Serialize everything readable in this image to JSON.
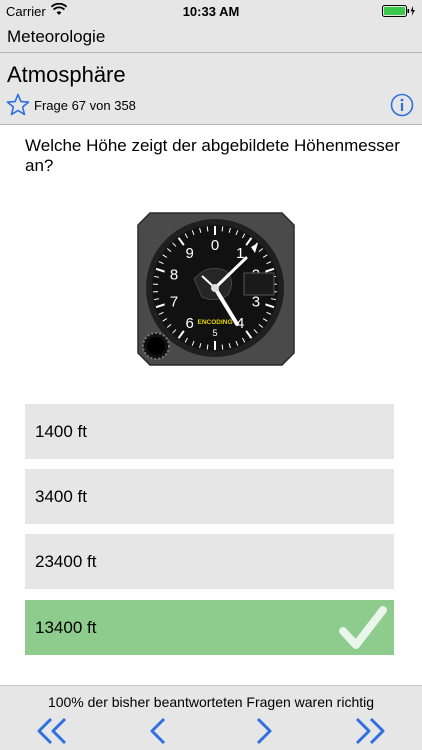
{
  "status_bar": {
    "carrier": "Carrier",
    "time": "10:33 AM"
  },
  "nav": {
    "title": "Meteorologie"
  },
  "header": {
    "topic": "Atmosphäre",
    "question_counter": "Frage 67 von 358"
  },
  "question": {
    "text": "Welche Höhe zeigt der abgebildete Höhenmesser an?"
  },
  "altimeter": {
    "dial_numbers": [
      "0",
      "1",
      "2",
      "3",
      "4",
      "5",
      "6",
      "7",
      "8",
      "9"
    ],
    "label": "ENCODING"
  },
  "answers": [
    {
      "label": "1400 ft",
      "correct": false
    },
    {
      "label": "3400 ft",
      "correct": false
    },
    {
      "label": "23400 ft",
      "correct": false
    },
    {
      "label": "13400 ft",
      "correct": true
    }
  ],
  "footer": {
    "result_text": "100% der bisher beantworteten Fragen waren richtig"
  },
  "colors": {
    "accent": "#2f6fe0",
    "correct": "#8dcc8d",
    "panel": "#e6e6e6"
  },
  "icons": [
    "wifi-icon",
    "battery-icon",
    "star-icon",
    "info-icon",
    "check-icon",
    "first-icon",
    "previous-icon",
    "next-icon",
    "last-icon"
  ]
}
